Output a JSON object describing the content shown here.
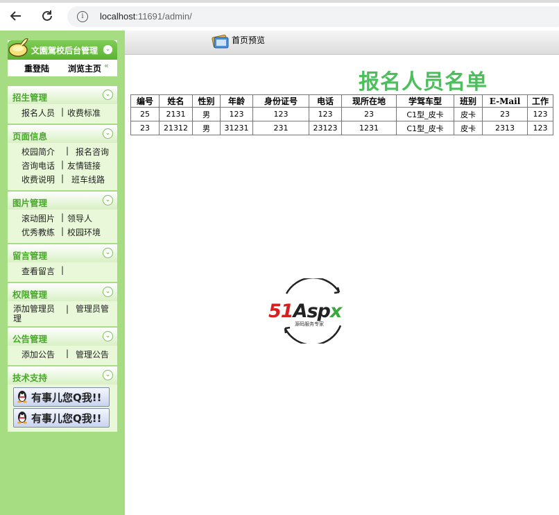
{
  "browser": {
    "url_host": "localhost",
    "url_rest": ":11691/admin/"
  },
  "sidebar": {
    "app_title": "文園駕校后台管理",
    "relogin": "重登陆",
    "browse_home": "浏览主页",
    "sections": [
      {
        "title": "招生管理",
        "rows": [
          [
            "报名人员",
            "收费标准"
          ]
        ]
      },
      {
        "title": "页面信息",
        "rows": [
          [
            "校园简介",
            "报名咨询"
          ],
          [
            "咨询电话",
            "友情链接"
          ],
          [
            "收费说明",
            "班车线路"
          ]
        ]
      },
      {
        "title": "图片管理",
        "rows": [
          [
            "滚动图片",
            "领导人"
          ],
          [
            "优秀教练",
            "校园环境"
          ]
        ]
      },
      {
        "title": "留言管理",
        "rows": [
          [
            "查看留言",
            ""
          ]
        ]
      },
      {
        "title": "权限管理",
        "rows": [
          [
            "添加管理员",
            "管理员管理"
          ]
        ]
      },
      {
        "title": "公告管理",
        "rows": [
          [
            "添加公告",
            "管理公告"
          ]
        ]
      },
      {
        "title": "技术支持",
        "rows": []
      }
    ],
    "qq_button": "有事儿您Q我!!"
  },
  "topbar": {
    "preview": "首页预览"
  },
  "main": {
    "title": "报名人员名单",
    "table": {
      "headers": [
        "编号",
        "姓名",
        "性别",
        "年龄",
        "身份证号",
        "电话",
        "现所在地",
        "学驾车型",
        "班别",
        "E-Mail",
        "工作"
      ],
      "rows": [
        [
          "25",
          "2131",
          "男",
          "123",
          "123",
          "123",
          "23",
          "C1型_皮卡",
          "皮卡",
          "23",
          "123"
        ],
        [
          "23",
          "21312",
          "男",
          "31231",
          "231",
          "23123",
          "1231",
          "C1型_皮卡",
          "皮卡",
          "2313",
          "123"
        ]
      ]
    },
    "watermark": {
      "brand": "51Aspx",
      "tagline": "源码服务专家"
    }
  }
}
